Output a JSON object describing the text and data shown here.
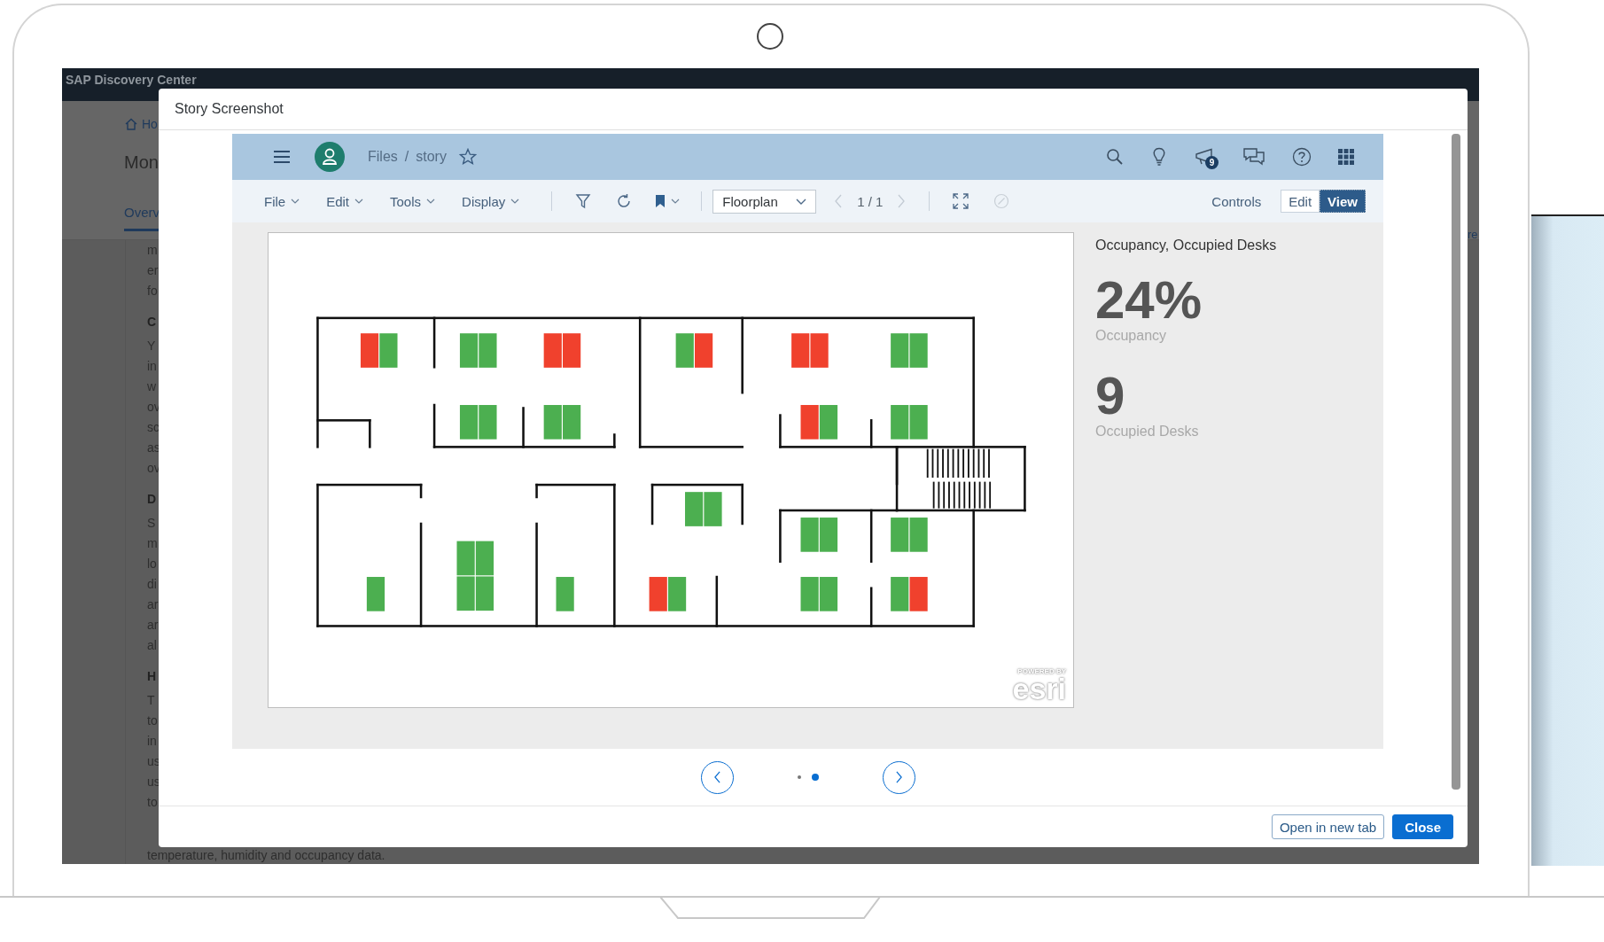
{
  "background_page": {
    "brand": "SAP Discovery Center",
    "breadcrumb": "Ho",
    "title": "Mon",
    "tab": "Overv",
    "side_link": "re",
    "text_lines": [
      {
        "kind": "text",
        "text": "m"
      },
      {
        "kind": "text",
        "text": "er"
      },
      {
        "kind": "text",
        "text": "fo"
      },
      {
        "kind": "heading",
        "text": "C"
      },
      {
        "kind": "text",
        "text": "Y"
      },
      {
        "kind": "text",
        "text": "in"
      },
      {
        "kind": "text",
        "text": "w"
      },
      {
        "kind": "text",
        "text": "ov"
      },
      {
        "kind": "text",
        "text": "sc"
      },
      {
        "kind": "text",
        "text": "as"
      },
      {
        "kind": "text",
        "text": "ov"
      },
      {
        "kind": "heading",
        "text": "D"
      },
      {
        "kind": "text",
        "text": "S"
      },
      {
        "kind": "text",
        "text": "m"
      },
      {
        "kind": "text",
        "text": "lo"
      },
      {
        "kind": "text",
        "text": "di"
      },
      {
        "kind": "text",
        "text": "ar"
      },
      {
        "kind": "text",
        "text": "ar"
      },
      {
        "kind": "text",
        "text": "al"
      },
      {
        "kind": "heading",
        "text": "H"
      },
      {
        "kind": "text",
        "text": "T"
      },
      {
        "kind": "text",
        "text": "to"
      },
      {
        "kind": "text",
        "text": "in"
      },
      {
        "kind": "text",
        "text": "us"
      },
      {
        "kind": "text",
        "text": "us"
      },
      {
        "kind": "text",
        "text": "to"
      }
    ],
    "footer_line": "temperature, humidity and occupancy data."
  },
  "dialog": {
    "title": "Story Screenshot",
    "story": {
      "shell": {
        "breadcrumb": [
          "Files",
          "story"
        ],
        "separator": "/",
        "notification_count": "9"
      },
      "toolbar": {
        "menus": [
          "File",
          "Edit",
          "Tools",
          "Display"
        ],
        "page_select": "Floorplan",
        "page": "1 / 1",
        "controls": "Controls",
        "modes": [
          {
            "label": "Edit",
            "selected": false
          },
          {
            "label": "View",
            "selected": true
          }
        ]
      },
      "map": {
        "attribution_top": "POWERED BY",
        "attribution_brand": "esri",
        "desks": [
          {
            "seats": [
              {
                "occupied": true
              },
              {
                "occupied": false
              }
            ]
          },
          {
            "seats": [
              {
                "occupied": false
              },
              {
                "occupied": false
              }
            ]
          },
          {
            "seats": [
              {
                "occupied": true
              },
              {
                "occupied": true
              }
            ]
          },
          {
            "seats": [
              {
                "occupied": false
              },
              {
                "occupied": true
              }
            ]
          },
          {
            "seats": [
              {
                "occupied": true
              },
              {
                "occupied": true
              }
            ]
          },
          {
            "seats": [
              {
                "occupied": false
              },
              {
                "occupied": false
              }
            ]
          },
          {
            "seats": [
              {
                "occupied": false
              },
              {
                "occupied": false
              }
            ]
          },
          {
            "seats": [
              {
                "occupied": false
              },
              {
                "occupied": false
              }
            ]
          },
          {
            "seats": [
              {
                "occupied": true
              },
              {
                "occupied": false
              }
            ]
          },
          {
            "seats": [
              {
                "occupied": false
              },
              {
                "occupied": false
              }
            ]
          },
          {
            "seats": [
              {
                "occupied": false
              },
              {
                "occupied": false
              }
            ]
          },
          {
            "seats": [
              {
                "occupied": false
              },
              {
                "occupied": false
              }
            ]
          },
          {
            "seats": [
              {
                "occupied": false
              },
              {
                "occupied": false
              }
            ]
          },
          {
            "seats": [
              {
                "occupied": false
              }
            ]
          },
          {
            "seats": [
              {
                "occupied": false
              },
              {
                "occupied": false
              },
              {
                "occupied": false
              },
              {
                "occupied": false
              }
            ]
          },
          {
            "seats": [
              {
                "occupied": false
              }
            ]
          },
          {
            "seats": [
              {
                "occupied": true
              },
              {
                "occupied": false
              }
            ]
          },
          {
            "seats": [
              {
                "occupied": false
              },
              {
                "occupied": false
              }
            ]
          },
          {
            "seats": [
              {
                "occupied": false
              },
              {
                "occupied": true
              }
            ]
          }
        ]
      },
      "kpi": {
        "title": "Occupancy, Occupied Desks",
        "metrics": [
          {
            "value": "24%",
            "label": "Occupancy"
          },
          {
            "value": "9",
            "label": "Occupied Desks"
          }
        ]
      }
    },
    "carousel": {
      "dots": [
        {
          "selected": false
        },
        {
          "selected": true
        }
      ]
    },
    "buttons": [
      {
        "label": "Open in new tab",
        "kind": "secondary"
      },
      {
        "label": "Close",
        "kind": "primary"
      }
    ]
  }
}
